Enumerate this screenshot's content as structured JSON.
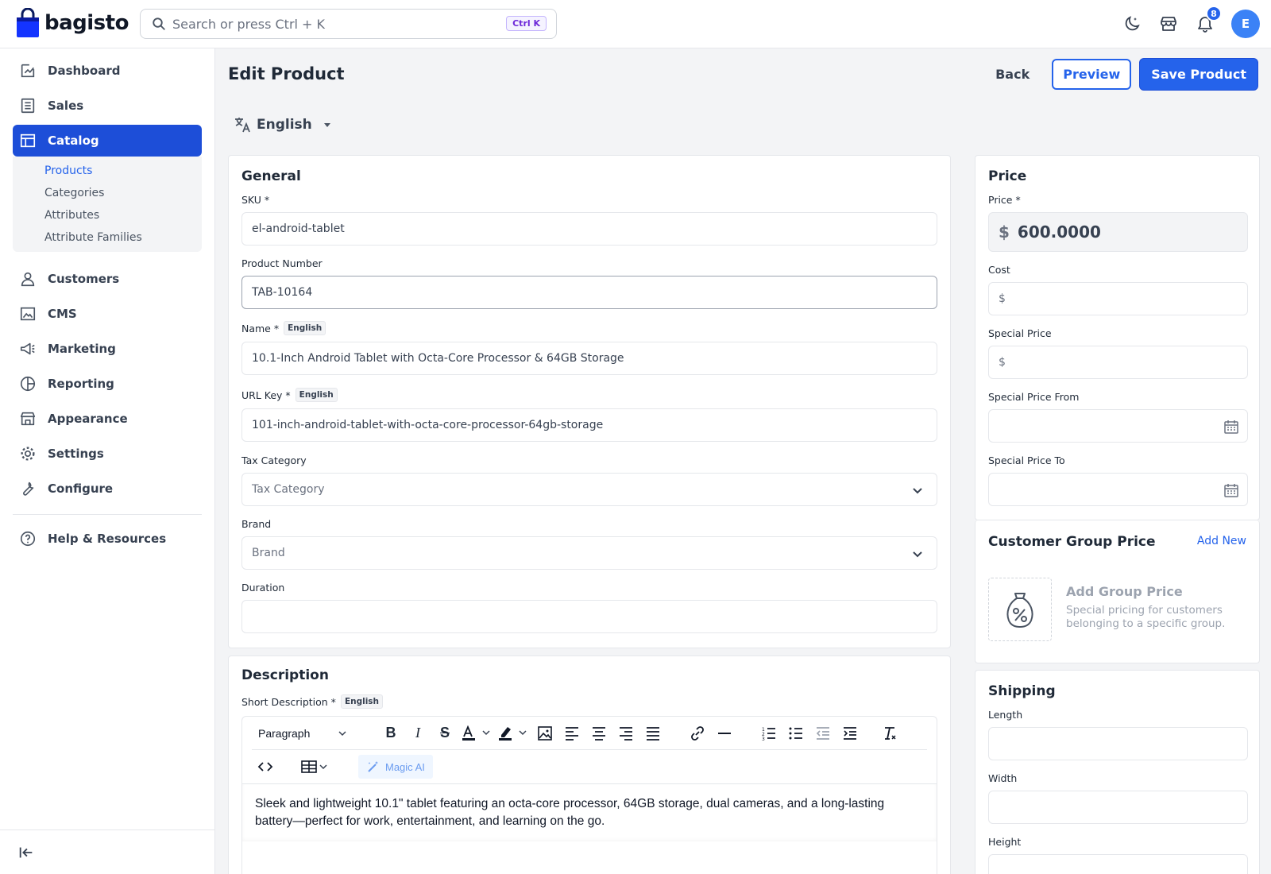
{
  "app": {
    "name": "bagisto"
  },
  "search": {
    "placeholder": "Search or press Ctrl + K",
    "shortcut": "Ctrl K"
  },
  "notifications": {
    "count": "8"
  },
  "user": {
    "initial": "E"
  },
  "colors": {
    "accent": "#2563eb",
    "sidebar_active": "#1d4ed8",
    "background": "#f3f4f6"
  },
  "sidebar": {
    "items": [
      {
        "label": "Dashboard",
        "icon": "dashboard-icon"
      },
      {
        "label": "Sales",
        "icon": "sales-icon"
      },
      {
        "label": "Catalog",
        "icon": "catalog-icon",
        "active": true
      },
      {
        "label": "Customers",
        "icon": "customers-icon"
      },
      {
        "label": "CMS",
        "icon": "cms-icon"
      },
      {
        "label": "Marketing",
        "icon": "marketing-icon"
      },
      {
        "label": "Reporting",
        "icon": "reporting-icon"
      },
      {
        "label": "Appearance",
        "icon": "appearance-icon"
      },
      {
        "label": "Settings",
        "icon": "settings-icon"
      },
      {
        "label": "Configure",
        "icon": "configure-icon"
      },
      {
        "label": "Help & Resources",
        "icon": "help-icon"
      }
    ],
    "catalog_sub": [
      "Products",
      "Categories",
      "Attributes",
      "Attribute Families"
    ]
  },
  "page": {
    "title": "Edit Product",
    "back_label": "Back",
    "preview_label": "Preview",
    "save_label": "Save Product",
    "locale": "English"
  },
  "general": {
    "title": "General",
    "sku_label": "SKU *",
    "sku_value": "el-android-tablet",
    "product_number_label": "Product Number",
    "product_number_value": "TAB-10164",
    "name_label": "Name *",
    "name_value": "10.1-Inch Android Tablet with Octa-Core Processor & 64GB Storage",
    "url_key_label": "URL Key *",
    "url_key_value": "101-inch-android-tablet-with-octa-core-processor-64gb-storage",
    "locale_tag": "English",
    "tax_category_label": "Tax Category",
    "tax_category_placeholder": "Tax Category",
    "brand_label": "Brand",
    "brand_placeholder": "Brand",
    "duration_label": "Duration",
    "duration_value": ""
  },
  "description": {
    "title": "Description",
    "short_label": "Short Description *",
    "locale_tag": "English",
    "format_select": "Paragraph",
    "magic_ai_label": "Magic AI",
    "short_text": "Sleek and lightweight 10.1\" tablet featuring an octa-core processor, 64GB storage, dual cameras, and a long-lasting battery—perfect for work, entertainment, and learning on the go."
  },
  "price": {
    "title": "Price",
    "price_label": "Price *",
    "currency": "$",
    "price_value": "600.0000",
    "cost_label": "Cost",
    "special_price_label": "Special Price",
    "special_from_label": "Special Price From",
    "special_to_label": "Special Price To"
  },
  "group_price": {
    "title": "Customer Group Price",
    "add_new": "Add New",
    "empty_title": "Add Group Price",
    "empty_desc": "Special pricing for customers belonging to a specific group."
  },
  "shipping": {
    "title": "Shipping",
    "length_label": "Length",
    "width_label": "Width",
    "height_label": "Height"
  }
}
